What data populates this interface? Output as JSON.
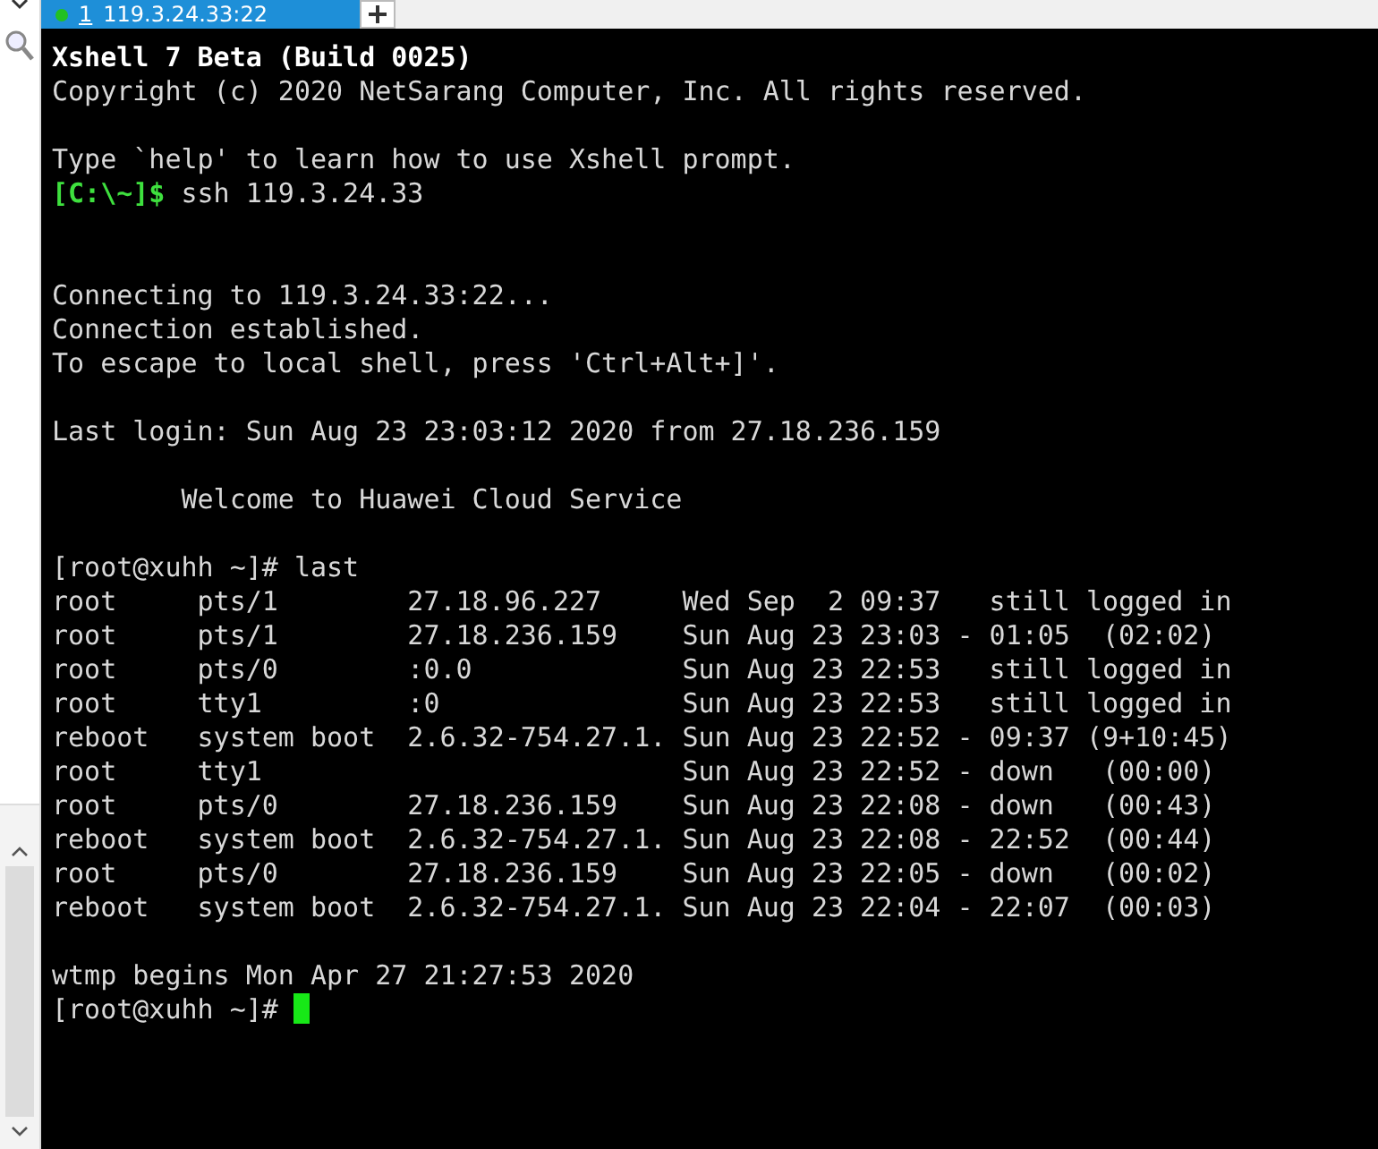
{
  "tab": {
    "number": "1",
    "title": "119.3.24.33:22",
    "selected": true
  },
  "terminal": {
    "lines": [
      {
        "kind": "bold",
        "text": "Xshell 7 Beta (Build 0025)"
      },
      {
        "kind": "plain",
        "text": "Copyright (c) 2020 NetSarang Computer, Inc. All rights reserved."
      },
      {
        "kind": "blank"
      },
      {
        "kind": "plain",
        "text": "Type `help' to learn how to use Xshell prompt."
      },
      {
        "kind": "local_prompt",
        "prompt": "[C:\\~]$",
        "command": "ssh 119.3.24.33"
      },
      {
        "kind": "blank"
      },
      {
        "kind": "blank"
      },
      {
        "kind": "plain",
        "text": "Connecting to 119.3.24.33:22..."
      },
      {
        "kind": "plain",
        "text": "Connection established."
      },
      {
        "kind": "plain",
        "text": "To escape to local shell, press 'Ctrl+Alt+]'."
      },
      {
        "kind": "blank"
      },
      {
        "kind": "plain",
        "text": "Last login: Sun Aug 23 23:03:12 2020 from 27.18.236.159"
      },
      {
        "kind": "blank"
      },
      {
        "kind": "plain",
        "text": "        Welcome to Huawei Cloud Service"
      },
      {
        "kind": "blank"
      },
      {
        "kind": "plain",
        "text": "[root@xuhh ~]# last"
      },
      {
        "kind": "plain",
        "text": "root     pts/1        27.18.96.227     Wed Sep  2 09:37   still logged in"
      },
      {
        "kind": "plain",
        "text": "root     pts/1        27.18.236.159    Sun Aug 23 23:03 - 01:05  (02:02)"
      },
      {
        "kind": "plain",
        "text": "root     pts/0        :0.0             Sun Aug 23 22:53   still logged in"
      },
      {
        "kind": "plain",
        "text": "root     tty1         :0               Sun Aug 23 22:53   still logged in"
      },
      {
        "kind": "plain",
        "text": "reboot   system boot  2.6.32-754.27.1. Sun Aug 23 22:52 - 09:37 (9+10:45)"
      },
      {
        "kind": "plain",
        "text": "root     tty1                          Sun Aug 23 22:52 - down   (00:00)"
      },
      {
        "kind": "plain",
        "text": "root     pts/0        27.18.236.159    Sun Aug 23 22:08 - down   (00:43)"
      },
      {
        "kind": "plain",
        "text": "reboot   system boot  2.6.32-754.27.1. Sun Aug 23 22:08 - 22:52  (00:44)"
      },
      {
        "kind": "plain",
        "text": "root     pts/0        27.18.236.159    Sun Aug 23 22:05 - down   (00:02)"
      },
      {
        "kind": "plain",
        "text": "reboot   system boot  2.6.32-754.27.1. Sun Aug 23 22:04 - 22:07  (00:03)"
      },
      {
        "kind": "blank"
      },
      {
        "kind": "plain",
        "text": "wtmp begins Mon Apr 27 21:27:53 2020"
      },
      {
        "kind": "cursor",
        "text": "[root@xuhh ~]#"
      }
    ]
  }
}
